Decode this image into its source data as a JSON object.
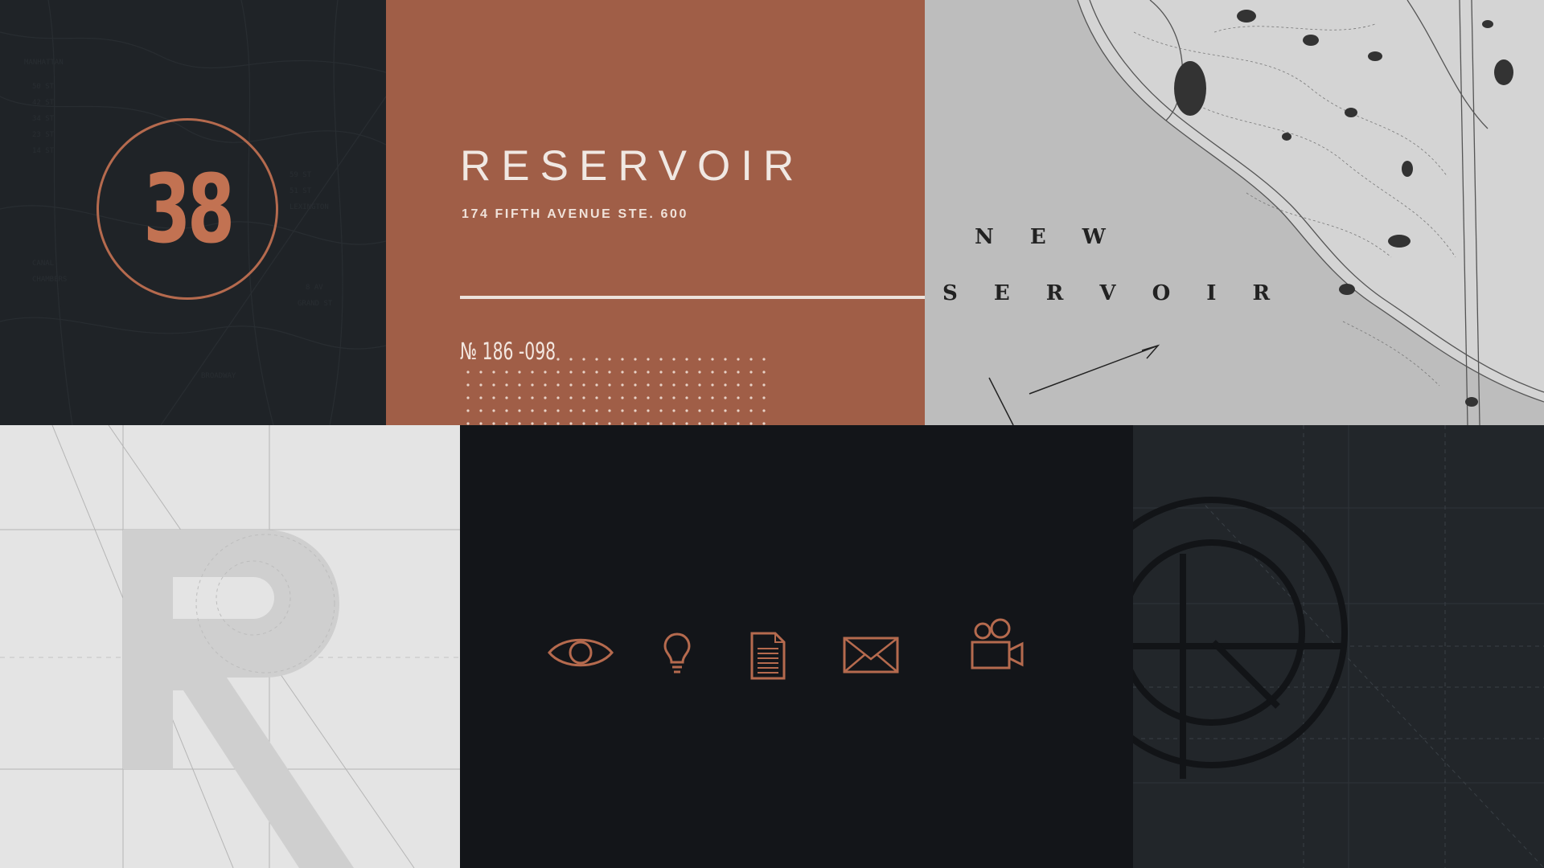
{
  "badge": {
    "number": "38"
  },
  "card": {
    "brand": "RESERVOIR",
    "address": "174 FIFTH AVENUE STE. 600",
    "reference": "№ 186 -098"
  },
  "map": {
    "label_line1": "N E W",
    "label_line2": "S E R V O I R"
  },
  "icons": [
    "eye-icon",
    "lightbulb-icon",
    "document-icon",
    "envelope-icon",
    "video-camera-icon"
  ],
  "colors": {
    "accent": "#a05e47",
    "accent_line": "#c27252",
    "charcoal": "#1f2327",
    "ink": "#131519",
    "paper": "#e4e4e4"
  }
}
